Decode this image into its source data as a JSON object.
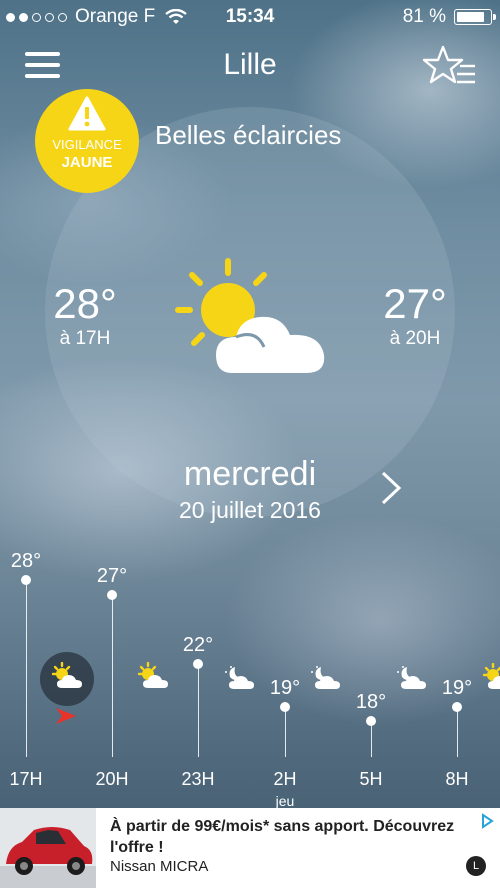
{
  "status_bar": {
    "carrier": "Orange F",
    "time": "15:34",
    "battery": "81 %",
    "signal_bars_filled": 2
  },
  "header": {
    "city": "Lille"
  },
  "vigilance": {
    "line1": "VIGILANCE",
    "line2": "JAUNE",
    "color": "#f6d416"
  },
  "forecast": {
    "condition": "Belles éclaircies",
    "left_temp": "28°",
    "left_time": "à 17H",
    "right_temp": "27°",
    "right_time": "à 20H",
    "icon": "sun-cloud-icon",
    "day": "mercredi",
    "date": "20 juillet 2016"
  },
  "timeline": [
    {
      "hour": "17H",
      "temp": "28°",
      "icon": "sun-cloud-icon",
      "current": true
    },
    {
      "hour": "20H",
      "temp": "27°",
      "icon": "sun-cloud-icon"
    },
    {
      "hour": "23H",
      "temp": "22°",
      "icon": "moon-cloud-icon"
    },
    {
      "hour": "2H",
      "temp": "19°",
      "icon": "moon-cloud-icon",
      "sub": "jeu"
    },
    {
      "hour": "5H",
      "temp": "18°",
      "icon": "moon-cloud-icon"
    },
    {
      "hour": "8H",
      "temp": "19°",
      "icon": "sun-cloud-icon"
    }
  ],
  "ad": {
    "headline": "À partir de 99€/mois* sans apport. Découvrez l'offre !",
    "brand": "Nissan MICRA",
    "badge": "L"
  }
}
